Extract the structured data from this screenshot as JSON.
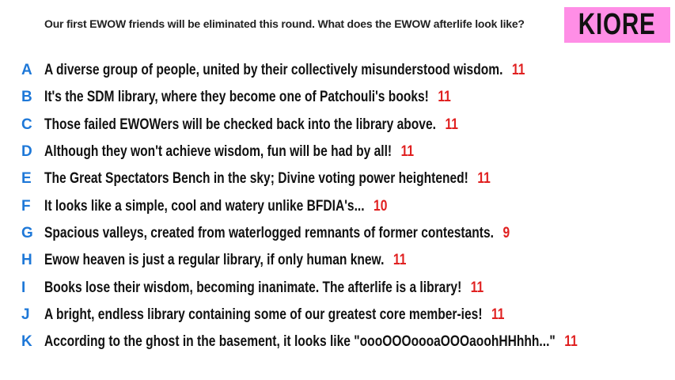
{
  "prompt": "Our first EWOW friends will be eliminated this round. What does the EWOW afterlife look like?",
  "badge": "KIORE",
  "colors": {
    "letter": "#1e78d8",
    "score": "#e02020",
    "badge": "#ff8ee6"
  },
  "responses": [
    {
      "letter": "A",
      "text": "A diverse group of people, united by their collectively misunderstood wisdom.",
      "score": "11"
    },
    {
      "letter": "B",
      "text": "It's the SDM library, where they become one of Patchouli's books!",
      "score": "11"
    },
    {
      "letter": "C",
      "text": "Those failed EWOWers will be checked back into the library above.",
      "score": "11"
    },
    {
      "letter": "D",
      "text": "Although they won't achieve wisdom, fun will be had by all!",
      "score": "11"
    },
    {
      "letter": "E",
      "text": "The Great Spectators Bench in the sky; Divine voting power heightened!",
      "score": "11"
    },
    {
      "letter": "F",
      "text": "It looks like a simple, cool and watery unlike BFDIA's...",
      "score": "10"
    },
    {
      "letter": "G",
      "text": "Spacious valleys, created from waterlogged remnants of former contestants.",
      "score": "9"
    },
    {
      "letter": "H",
      "text": "Ewow heaven is just a regular library, if only human knew.",
      "score": "11"
    },
    {
      "letter": "I",
      "text": "Books lose their wisdom, becoming inanimate. The afterlife is a library!",
      "score": "11"
    },
    {
      "letter": "J",
      "text": "A bright, endless library containing some of our greatest core member-ies!",
      "score": "11"
    },
    {
      "letter": "K",
      "text": "According to the ghost in the basement, it looks like \"oooOOOoooaOOOaoohHHhhh...\"",
      "score": "11"
    }
  ]
}
